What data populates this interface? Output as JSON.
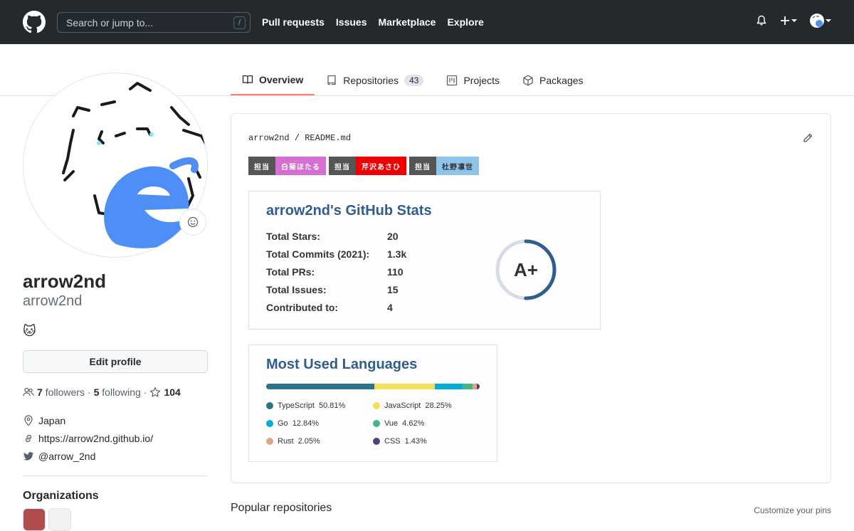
{
  "header": {
    "search_placeholder": "Search or jump to...",
    "search_shortcut": "/",
    "nav": [
      "Pull requests",
      "Issues",
      "Marketplace",
      "Explore"
    ]
  },
  "tabs": [
    {
      "label": "Overview",
      "icon": "book-icon",
      "active": true
    },
    {
      "label": "Repositories",
      "icon": "repo-icon",
      "count": "43"
    },
    {
      "label": "Projects",
      "icon": "project-icon"
    },
    {
      "label": "Packages",
      "icon": "package-icon"
    }
  ],
  "profile": {
    "name": "arrow2nd",
    "login": "arrow2nd",
    "bio": "🐱",
    "edit_label": "Edit profile",
    "followers_count": "7",
    "followers_label": "followers",
    "following_count": "5",
    "following_label": "following",
    "stars": "104",
    "location": "Japan",
    "website": "https://arrow2nd.github.io/",
    "twitter": "@arrow_2nd",
    "orgs_title": "Organizations"
  },
  "readme": {
    "owner": "arrow2nd",
    "file": "README.md",
    "badges": [
      {
        "label": "担当",
        "value": "白菊ほたる",
        "color": "#d56fd1"
      },
      {
        "label": "担当",
        "value": "芹沢あさひ",
        "color": "#ef0000"
      },
      {
        "label": "担当",
        "value": "杜野凛世",
        "color": "#8ec3eb"
      }
    ]
  },
  "stats": {
    "title": "arrow2nd's GitHub Stats",
    "rows": [
      {
        "label": "Total Stars:",
        "value": "20"
      },
      {
        "label": "Total Commits (2021):",
        "value": "1.3k"
      },
      {
        "label": "Total PRs:",
        "value": "110"
      },
      {
        "label": "Total Issues:",
        "value": "15"
      },
      {
        "label": "Contributed to:",
        "value": "4"
      }
    ],
    "rank": "A+",
    "rank_progress": 0.5,
    "title_color": "#2f5d8f"
  },
  "languages": {
    "title": "Most Used Languages",
    "items": [
      {
        "name": "TypeScript",
        "percent": "50.81%",
        "value": 50.81,
        "color": "#2b7489"
      },
      {
        "name": "JavaScript",
        "percent": "28.25%",
        "value": 28.25,
        "color": "#f1e05a"
      },
      {
        "name": "Go",
        "percent": "12.84%",
        "value": 12.84,
        "color": "#00add8"
      },
      {
        "name": "Vue",
        "percent": "4.62%",
        "value": 4.62,
        "color": "#41b883"
      },
      {
        "name": "Rust",
        "percent": "2.05%",
        "value": 2.05,
        "color": "#dea584"
      },
      {
        "name": "CSS",
        "percent": "1.43%",
        "value": 1.43,
        "color": "#563d7c"
      }
    ]
  },
  "popular": {
    "title": "Popular repositories",
    "customize": "Customize your pins"
  }
}
